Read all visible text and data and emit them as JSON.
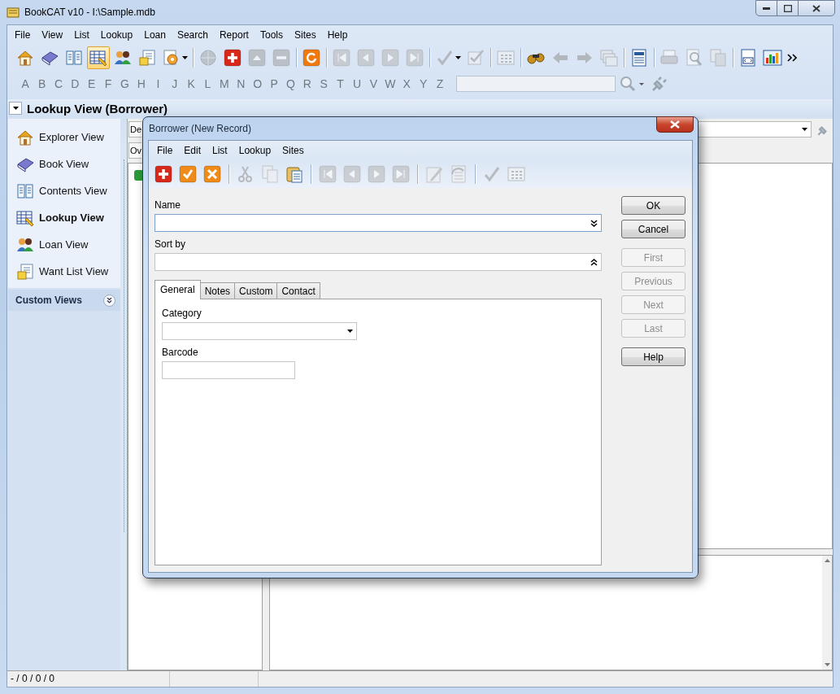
{
  "window": {
    "title": "BookCAT v10 - I:\\Sample.mdb"
  },
  "menu": [
    "File",
    "View",
    "List",
    "Lookup",
    "Loan",
    "Search",
    "Report",
    "Tools",
    "Sites",
    "Help"
  ],
  "toolbar": [
    {
      "kind": "home",
      "disabled": false,
      "selected": false
    },
    {
      "kind": "book",
      "disabled": false,
      "selected": false
    },
    {
      "kind": "contents",
      "disabled": false,
      "selected": false
    },
    {
      "kind": "lookup",
      "disabled": false,
      "selected": true
    },
    {
      "kind": "loan",
      "disabled": false,
      "selected": false
    },
    {
      "kind": "wantlist",
      "disabled": false,
      "selected": false
    },
    {
      "kind": "gear",
      "disabled": false,
      "selected": false,
      "caret": true
    },
    {
      "kind": "separator"
    },
    {
      "kind": "globe",
      "disabled": true,
      "selected": false
    },
    {
      "kind": "add",
      "disabled": false,
      "selected": false
    },
    {
      "kind": "up",
      "disabled": true,
      "selected": false
    },
    {
      "kind": "minus",
      "disabled": true,
      "selected": false
    },
    {
      "kind": "separator"
    },
    {
      "kind": "refresh",
      "disabled": false,
      "selected": false
    },
    {
      "kind": "separator"
    },
    {
      "kind": "first",
      "disabled": true,
      "selected": false
    },
    {
      "kind": "prev",
      "disabled": true,
      "selected": false
    },
    {
      "kind": "next",
      "disabled": true,
      "selected": false
    },
    {
      "kind": "last",
      "disabled": true,
      "selected": false
    },
    {
      "kind": "separator"
    },
    {
      "kind": "check",
      "disabled": true,
      "selected": false,
      "caret": true
    },
    {
      "kind": "checkdoc",
      "disabled": true,
      "selected": false
    },
    {
      "kind": "separator"
    },
    {
      "kind": "grid",
      "disabled": true,
      "selected": false
    },
    {
      "kind": "separator"
    },
    {
      "kind": "binoculars",
      "disabled": false,
      "selected": false
    },
    {
      "kind": "back",
      "disabled": true,
      "selected": false
    },
    {
      "kind": "forward",
      "disabled": true,
      "selected": false
    },
    {
      "kind": "windows",
      "disabled": true,
      "selected": false
    },
    {
      "kind": "separator"
    },
    {
      "kind": "report",
      "disabled": false,
      "selected": false
    },
    {
      "kind": "separator"
    },
    {
      "kind": "print",
      "disabled": true,
      "selected": false
    },
    {
      "kind": "preview",
      "disabled": true,
      "selected": false
    },
    {
      "kind": "copydoc",
      "disabled": true,
      "selected": false
    },
    {
      "kind": "separator"
    },
    {
      "kind": "html",
      "disabled": false,
      "selected": false
    },
    {
      "kind": "chart",
      "disabled": false,
      "selected": false
    },
    {
      "kind": "more",
      "disabled": false,
      "selected": false
    }
  ],
  "alphabet": [
    "A",
    "B",
    "C",
    "D",
    "E",
    "F",
    "G",
    "H",
    "I",
    "J",
    "K",
    "L",
    "M",
    "N",
    "O",
    "P",
    "Q",
    "R",
    "S",
    "T",
    "U",
    "V",
    "W",
    "X",
    "Y",
    "Z"
  ],
  "view_header": {
    "title": "Lookup View (Borrower)"
  },
  "sidebar": {
    "items": [
      {
        "label": "Explorer View",
        "kind": "home",
        "selected": false
      },
      {
        "label": "Book View",
        "kind": "book",
        "selected": false
      },
      {
        "label": "Contents View",
        "kind": "contents",
        "selected": false
      },
      {
        "label": "Lookup View",
        "kind": "lookup",
        "selected": true
      },
      {
        "label": "Loan View",
        "kind": "loan",
        "selected": false
      },
      {
        "label": "Want List View",
        "kind": "wantlist",
        "selected": false
      }
    ],
    "section": "Custom Views"
  },
  "background_tabs": [
    "De",
    "Ov"
  ],
  "status_bar": [
    "- / 0 / 0 / 0"
  ],
  "dialog": {
    "title": "Borrower (New Record)",
    "menu": [
      "File",
      "Edit",
      "List",
      "Lookup",
      "Sites"
    ],
    "toolbar": [
      {
        "kind": "add",
        "disabled": false
      },
      {
        "kind": "accept",
        "disabled": false
      },
      {
        "kind": "cancel",
        "disabled": false
      },
      {
        "kind": "separator"
      },
      {
        "kind": "cut",
        "disabled": true
      },
      {
        "kind": "copy",
        "disabled": true
      },
      {
        "kind": "paste",
        "disabled": false
      },
      {
        "kind": "separator"
      },
      {
        "kind": "first",
        "disabled": true
      },
      {
        "kind": "prev",
        "disabled": true
      },
      {
        "kind": "next",
        "disabled": true
      },
      {
        "kind": "last",
        "disabled": true
      },
      {
        "kind": "separator"
      },
      {
        "kind": "edit",
        "disabled": true
      },
      {
        "kind": "docsync",
        "disabled": true
      },
      {
        "kind": "separator"
      },
      {
        "kind": "check",
        "disabled": true
      },
      {
        "kind": "grid",
        "disabled": true
      }
    ],
    "fields": [
      {
        "label": "Name",
        "kind": "combo-down",
        "focused": true
      },
      {
        "label": "Sort by",
        "kind": "combo-up",
        "focused": false
      }
    ],
    "tabs": [
      {
        "label": "General",
        "selected": true
      },
      {
        "label": "Notes",
        "selected": false
      },
      {
        "label": "Custom",
        "selected": false
      },
      {
        "label": "Contact",
        "selected": false
      }
    ],
    "tab_fields": [
      {
        "label": "Category",
        "kind": "dropdown"
      },
      {
        "label": "Barcode",
        "kind": "text"
      }
    ],
    "buttons": [
      {
        "label": "OK",
        "disabled": false
      },
      {
        "label": "Cancel",
        "disabled": false
      },
      {
        "label": "First",
        "disabled": true
      },
      {
        "label": "Previous",
        "disabled": true
      },
      {
        "label": "Next",
        "disabled": true
      },
      {
        "label": "Last",
        "disabled": true
      },
      {
        "label": "Help",
        "disabled": false
      }
    ]
  }
}
